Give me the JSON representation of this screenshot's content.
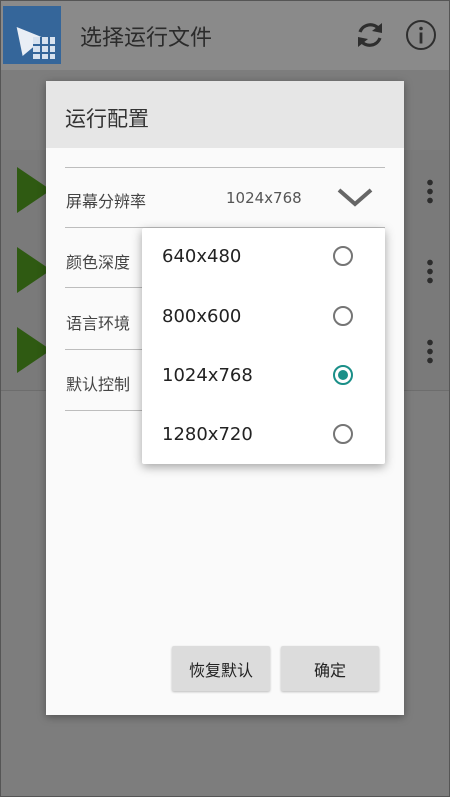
{
  "app": {
    "title": "选择运行文件"
  },
  "dialog": {
    "title": "运行配置",
    "rows": [
      {
        "label": "屏幕分辨率",
        "value": "1024x768"
      },
      {
        "label": "颜色深度"
      },
      {
        "label": "语言环境"
      },
      {
        "label": "默认控制"
      }
    ],
    "buttons": {
      "reset": "恢复默认",
      "ok": "确定"
    }
  },
  "dropdown": {
    "options": [
      "640x480",
      "800x600",
      "1024x768",
      "1280x720"
    ],
    "selected": "1024x768"
  },
  "colors": {
    "accent": "#1a8f88",
    "play": "#2f5a12",
    "logo": "#35669a"
  }
}
